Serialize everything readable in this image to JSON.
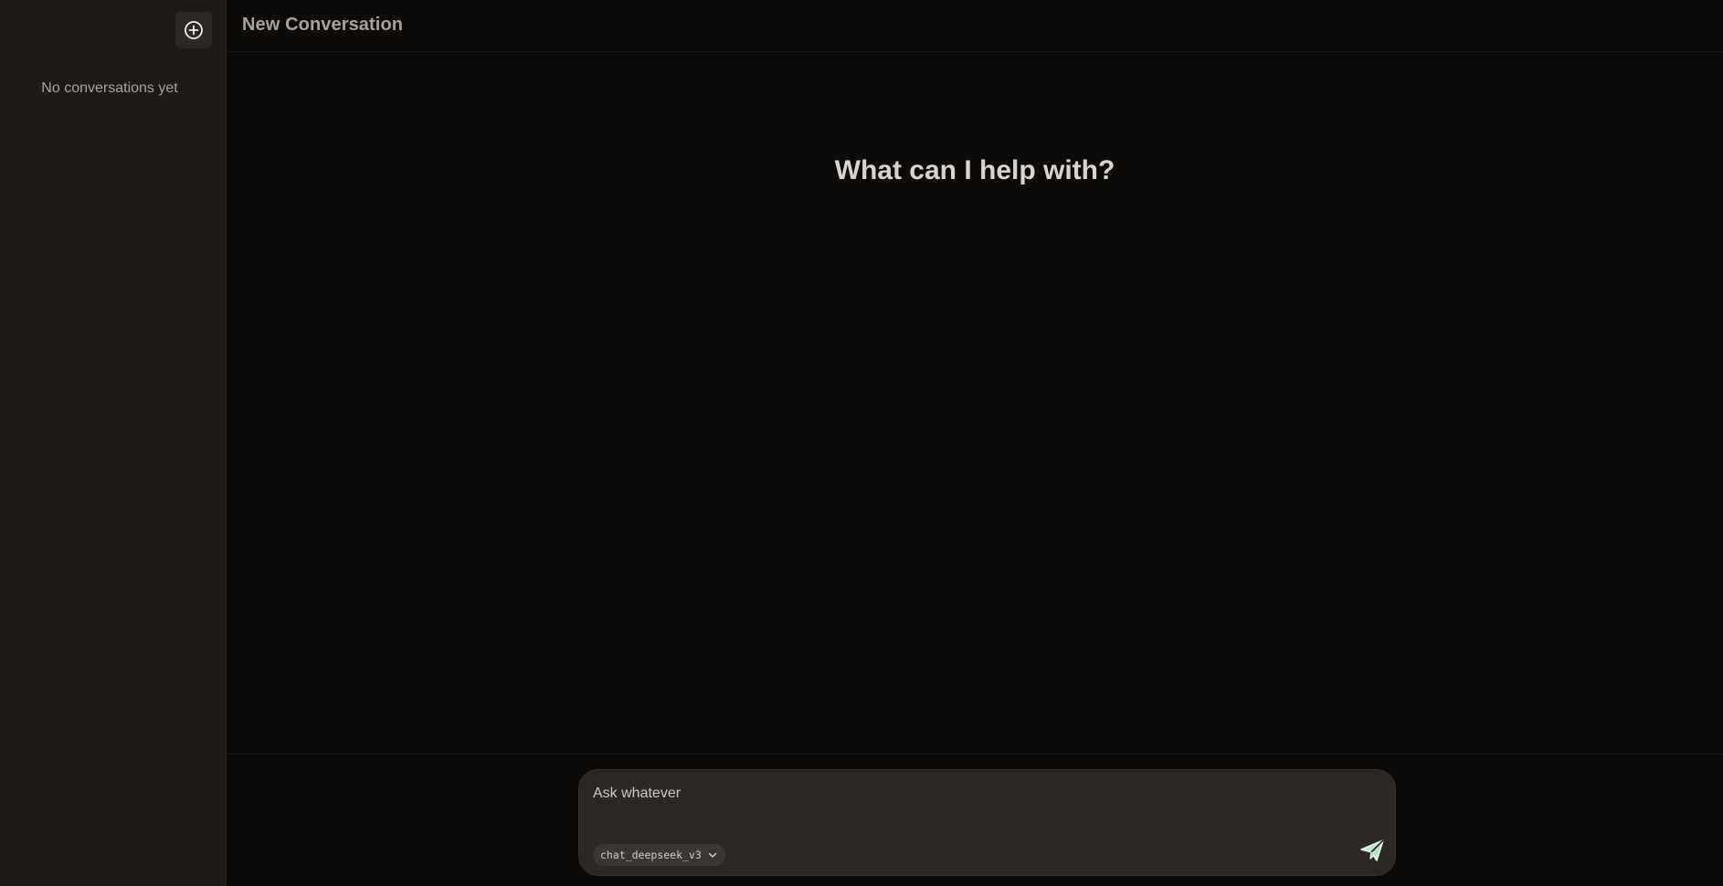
{
  "sidebar": {
    "new_chat_icon": "plus-circle-icon",
    "empty_text": "No conversations yet"
  },
  "header": {
    "title": "New Conversation"
  },
  "main": {
    "greeting": "What can I help with?"
  },
  "composer": {
    "placeholder": "Ask whatever",
    "value": "",
    "model": "chat_deepseek_v3",
    "model_icon": "chevron-down-icon",
    "send_icon": "paper-plane-icon"
  },
  "colors": {
    "sidebar_bg": "#1d1a18",
    "main_bg": "#0c0b0a",
    "composer_bg": "#2a2725",
    "send_accent": "#b9e6c4"
  }
}
